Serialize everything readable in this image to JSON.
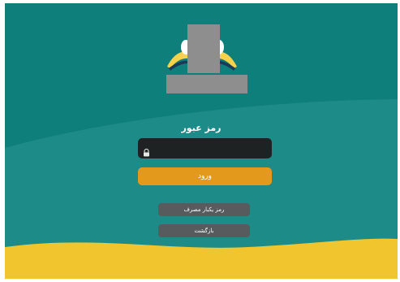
{
  "colors": {
    "background_teal": "#0f7f7c",
    "wave_teal": "#2a9893",
    "bottom_yellow": "#f0c52e",
    "primary_button": "#e39a1c",
    "secondary_button": "#585b5d",
    "input_background": "#1f2222"
  },
  "login": {
    "title": "رمز عبور",
    "password_placeholder": "",
    "lock_icon": "lock-icon",
    "submit_label": "ورود",
    "otp_label": "رمز یکبار مصرف",
    "back_label": "بازگشت"
  }
}
